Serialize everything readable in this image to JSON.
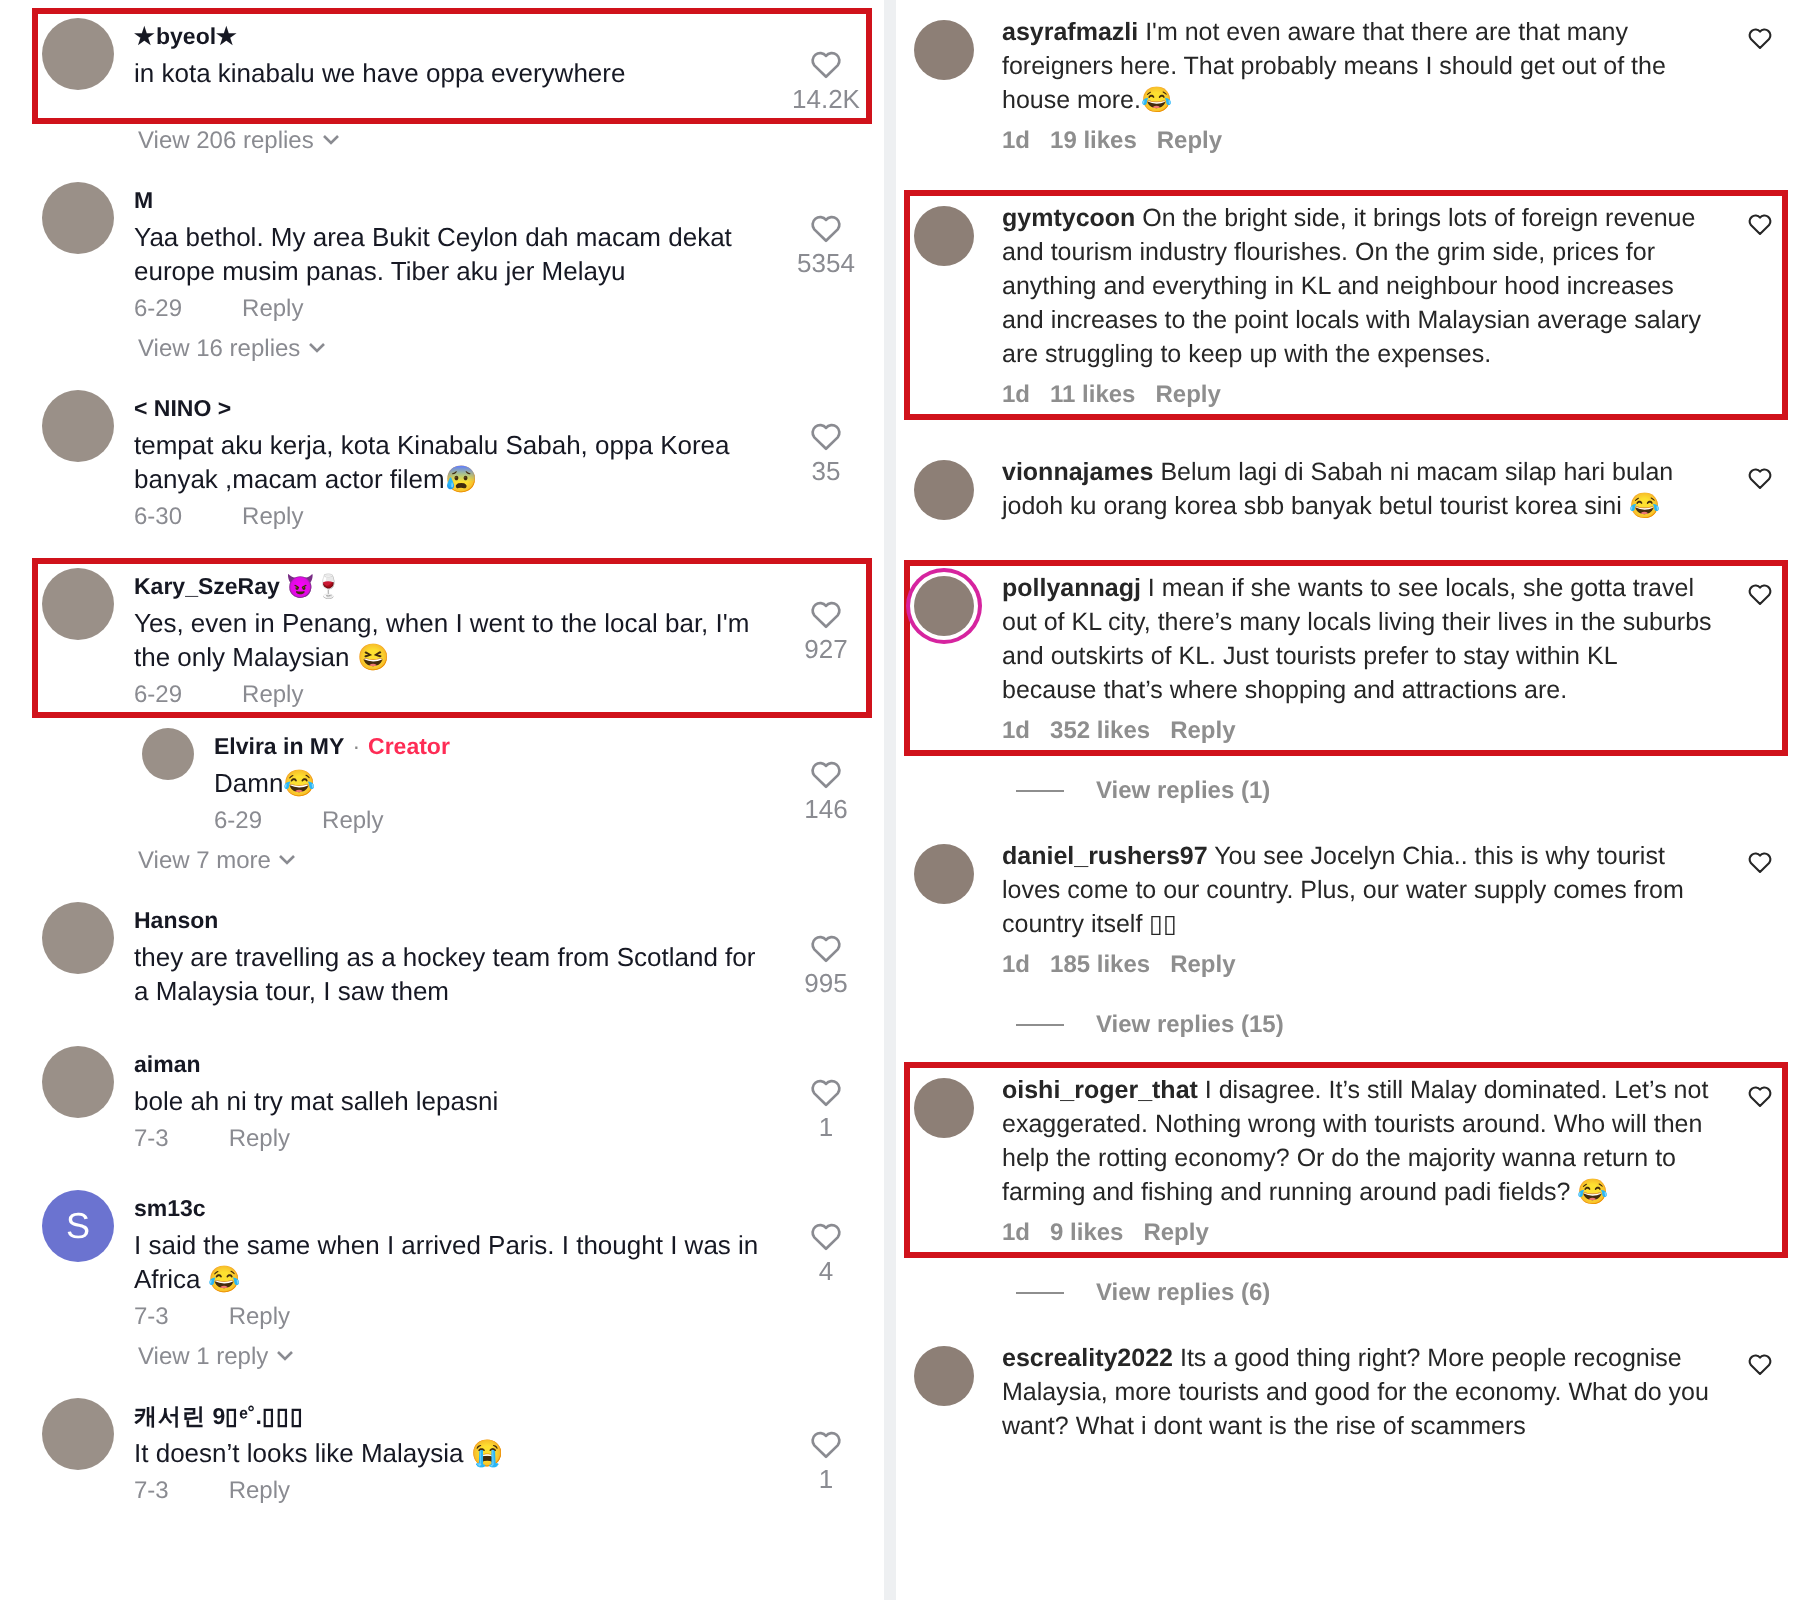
{
  "tiktok_comments": [
    {
      "username": "★byeol★",
      "text": "in kota kinabalu we have oppa everywhere",
      "likes": "14.2K",
      "highlighted": true,
      "view_more": "View 206 replies"
    },
    {
      "username": "M",
      "text": "Yaa bethol. My area Bukit Ceylon dah macam dekat europe musim panas. Tiber aku jer Melayu",
      "date": "6-29",
      "reply": "Reply",
      "likes": "5354",
      "highlighted": false,
      "view_more": "View 16 replies"
    },
    {
      "username": "< NINO >",
      "text": "tempat aku kerja, kota Kinabalu Sabah, oppa Korea banyak ,macam actor filem😰",
      "date": "6-30",
      "reply": "Reply",
      "likes": "35",
      "highlighted": false
    },
    {
      "username": "Kary_SzeRay 😈🍷",
      "text": "Yes, even in Penang, when I went to the local bar, I'm the only Malaysian 😆",
      "date": "6-29",
      "reply": "Reply",
      "likes": "927",
      "highlighted": true,
      "replies": [
        {
          "username": "Elvira in MY",
          "separator": "·",
          "badge": "Creator",
          "text": "Damn😂",
          "date": "6-29",
          "reply": "Reply",
          "likes": "146"
        }
      ],
      "view_more": "View 7 more"
    },
    {
      "username": "Hanson",
      "text": "they are travelling as a hockey team from Scotland for a Malaysia tour, I saw them",
      "likes": "995",
      "highlighted": false
    },
    {
      "username": "aiman",
      "text": "bole ah ni try mat salleh lepasni",
      "date": "7-3",
      "reply": "Reply",
      "likes": "1",
      "highlighted": false
    },
    {
      "username": "sm13c",
      "initial": "S",
      "text": "I said the same when I arrived Paris. I thought I was in Africa 😂",
      "date": "7-3",
      "reply": "Reply",
      "likes": "4",
      "highlighted": false,
      "view_more": "View 1 reply"
    },
    {
      "username": "캐서린 9▯ᵉ˚.▯▯▯",
      "text": "It doesn’t looks like Malaysia 😭",
      "date": "7-3",
      "reply": "Reply",
      "likes": "1",
      "highlighted": false
    }
  ],
  "instagram_comments": [
    {
      "username": "asyrafmazli",
      "text": "I'm not even aware that there are that many foreigners here. That probably means I should get out of the house more.😂",
      "age": "1d",
      "likes": "19 likes",
      "reply": "Reply",
      "highlighted": false,
      "story_ring": false
    },
    {
      "username": "gymtycoon",
      "text": "On the bright side, it brings lots of foreign revenue and tourism industry flourishes. On the grim side, prices for anything and everything in KL and neighbour hood increases and increases to the point locals with Malaysian average salary are struggling to keep up with the expenses.",
      "age": "1d",
      "likes": "11 likes",
      "reply": "Reply",
      "highlighted": true,
      "story_ring": false
    },
    {
      "username": "vionnajames",
      "text": "Belum lagi di Sabah ni macam silap hari bulan jodoh ku orang korea sbb banyak betul tourist korea sini 😂",
      "highlighted": false,
      "story_ring": false
    },
    {
      "username": "pollyannagj",
      "text": "I mean if she wants to see locals, she gotta travel out of KL city, there’s many locals living their lives in the suburbs and outskirts of KL. Just tourists prefer to stay within KL because that’s where shopping and attractions are.",
      "age": "1d",
      "likes": "352 likes",
      "reply": "Reply",
      "highlighted": true,
      "story_ring": true,
      "view_replies": "View replies (1)"
    },
    {
      "username": "daniel_rushers97",
      "text": "You see Jocelyn Chia.. this is why tourist loves come to our country. Plus, our water supply comes from country itself ▯▯",
      "age": "1d",
      "likes": "185 likes",
      "reply": "Reply",
      "highlighted": false,
      "story_ring": false,
      "view_replies": "View replies (15)"
    },
    {
      "username": "oishi_roger_that",
      "text": "I disagree. It’s still Malay dominated. Let’s not exaggerated. Nothing wrong with tourists around. Who will then help the rotting economy? Or do the majority wanna return to farming and fishing and running around padi fields? 😂",
      "age": "1d",
      "likes": "9 likes",
      "reply": "Reply",
      "highlighted": true,
      "story_ring": false,
      "view_replies": "View replies (6)"
    },
    {
      "username": "escreality2022",
      "text": "Its a good thing right? More people recognise Malaysia, more tourists and good for the economy. What do you want? What i dont want is the rise of scammers",
      "highlighted": false,
      "story_ring": false
    }
  ]
}
